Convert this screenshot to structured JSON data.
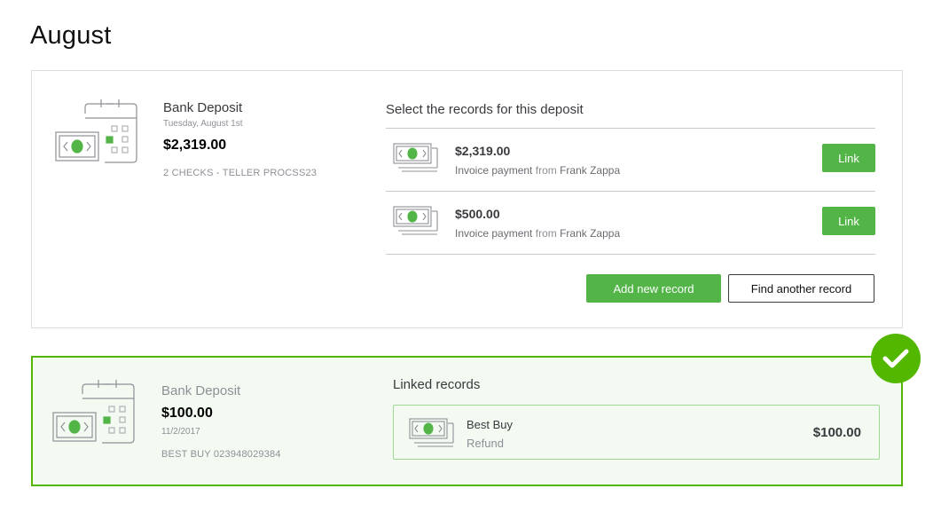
{
  "page": {
    "title": "August"
  },
  "pending_deposit": {
    "title": "Bank Deposit",
    "date": "Tuesday, August 1st",
    "amount": "$2,319.00",
    "memo": "2 CHECKS - TELLER PROCSS23",
    "illustration_icon": "calendar-money-icon",
    "records_heading": "Select the records for this deposit",
    "records": [
      {
        "amount": "$2,319.00",
        "type": "Invoice payment",
        "from_word": "from",
        "payer": "Frank Zappa",
        "button": "Link",
        "icon": "money-icon"
      },
      {
        "amount": "$500.00",
        "type": "Invoice payment",
        "from_word": "from",
        "payer": "Frank Zappa",
        "button": "Link",
        "icon": "money-icon"
      }
    ],
    "add_button": "Add new record",
    "find_button": "Find another record"
  },
  "linked_deposit": {
    "title": "Bank Deposit",
    "amount": "$100.00",
    "date": "11/2/2017",
    "memo": "BEST BUY 023948029384",
    "illustration_icon": "calendar-money-icon",
    "linked_heading": "Linked records",
    "linked_record": {
      "name": "Best Buy",
      "type": "Refund",
      "amount": "$100.00",
      "icon": "money-icon"
    },
    "status_icon": "checkmark-icon"
  },
  "colors": {
    "accent": "#53b548",
    "linked_border": "#53b700",
    "linked_bg": "#f3faf2",
    "text": "#393a3d",
    "muted": "#8d9096"
  }
}
